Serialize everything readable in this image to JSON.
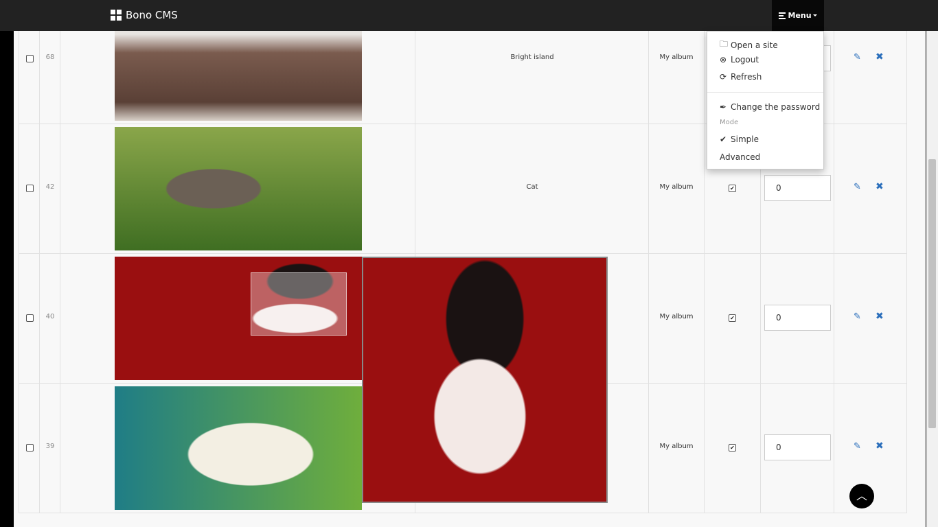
{
  "brand": {
    "name": "Bono CMS"
  },
  "menu": {
    "label": "Menu",
    "items": [
      {
        "icon": "folder-open-icon",
        "label": "Open a site"
      },
      {
        "icon": "times-circle-icon",
        "label": "Logout"
      },
      {
        "icon": "refresh-icon",
        "label": "Refresh"
      }
    ],
    "password_label": "Change the password",
    "mode_header": "Mode",
    "mode_simple": "Simple",
    "mode_advanced": "Advanced"
  },
  "rows": [
    {
      "id": "68",
      "title": "Bright island",
      "album": "My album",
      "order": ""
    },
    {
      "id": "42",
      "title": "Cat",
      "album": "My album",
      "order": "0"
    },
    {
      "id": "40",
      "title": "",
      "album": "My album",
      "order": "0"
    },
    {
      "id": "39",
      "title": "",
      "album": "My album",
      "order": "0"
    }
  ]
}
